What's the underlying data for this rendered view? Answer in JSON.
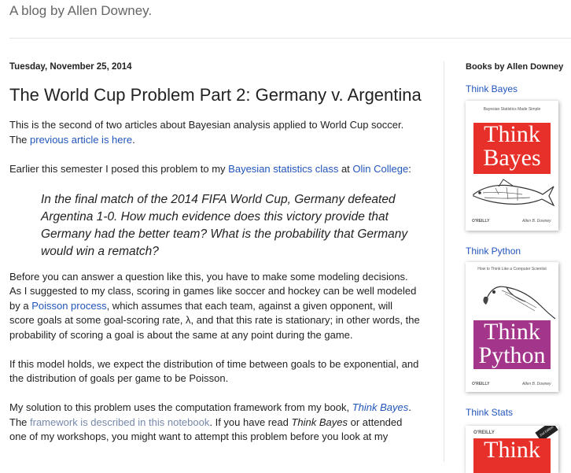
{
  "header": {
    "tagline": "A blog by Allen Downey."
  },
  "post": {
    "date": "Tuesday, November 25, 2014",
    "title": "The World Cup Problem Part 2: Germany v. Argentina",
    "p1": {
      "text1": "This is the second of two articles about Bayesian analysis applied to World Cup soccer.  The ",
      "link": "previous article is here",
      "text2": "."
    },
    "p2": {
      "text1": "Earlier this semester I posed this problem to my ",
      "link1": "Bayesian statistics class",
      "text2": " at ",
      "link2": "Olin College",
      "text3": ":"
    },
    "quote": "In the final match of the 2014 FIFA World Cup, Germany defeated Argentina 1-0. How much evidence does this victory provide that Germany had the better team? What is the probability that Germany would win a rematch?",
    "p3": {
      "text1": "Before you can answer a question like this, you have to make some modeling decisions.  As I suggested to my class, scoring in games like soccer and hockey can be well modeled by a ",
      "link": "Poisson process",
      "text2": ", which assumes that each team, against a given opponent, will score goals at some goal-scoring rate, λ, and that this rate is stationary; in other words, the probability of scoring a goal is about the same at any point during the game."
    },
    "p4": "If this model holds, we expect the distribution of time between goals to be exponential, and the distribution of goals per game to be Poisson.",
    "p5": {
      "text1": "My solution to this problem uses the computation framework from my book, ",
      "link1": "Think Bayes",
      "text2": ".  The ",
      "link2": "framework is described in this notebook",
      "text3": ".  If you have read ",
      "em": "Think Bayes",
      "text4": " or attended one of my workshops, you might want to attempt this problem before you look at my"
    }
  },
  "sidebar": {
    "title": "Books by Allen Downey",
    "books": [
      {
        "label": "Think Bayes",
        "cover_line1": "Think",
        "cover_line2": "Bayes",
        "color": "#e8302a",
        "publisher": "O'REILLY",
        "author": "Allen B. Downey",
        "topline": "Bayesian Statistics Made Simple"
      },
      {
        "label": "Think Python",
        "cover_line1": "Think",
        "cover_line2": "Python",
        "color": "#a3368a",
        "publisher": "O'REILLY",
        "author": "Allen B. Downey",
        "topline": "How to Think Like a Computer Scientist"
      },
      {
        "label": "Think Stats",
        "cover_line1": "Think",
        "color": "#e8302a",
        "publisher": "O'REILLY",
        "badge": "2nd Edition"
      }
    ]
  }
}
